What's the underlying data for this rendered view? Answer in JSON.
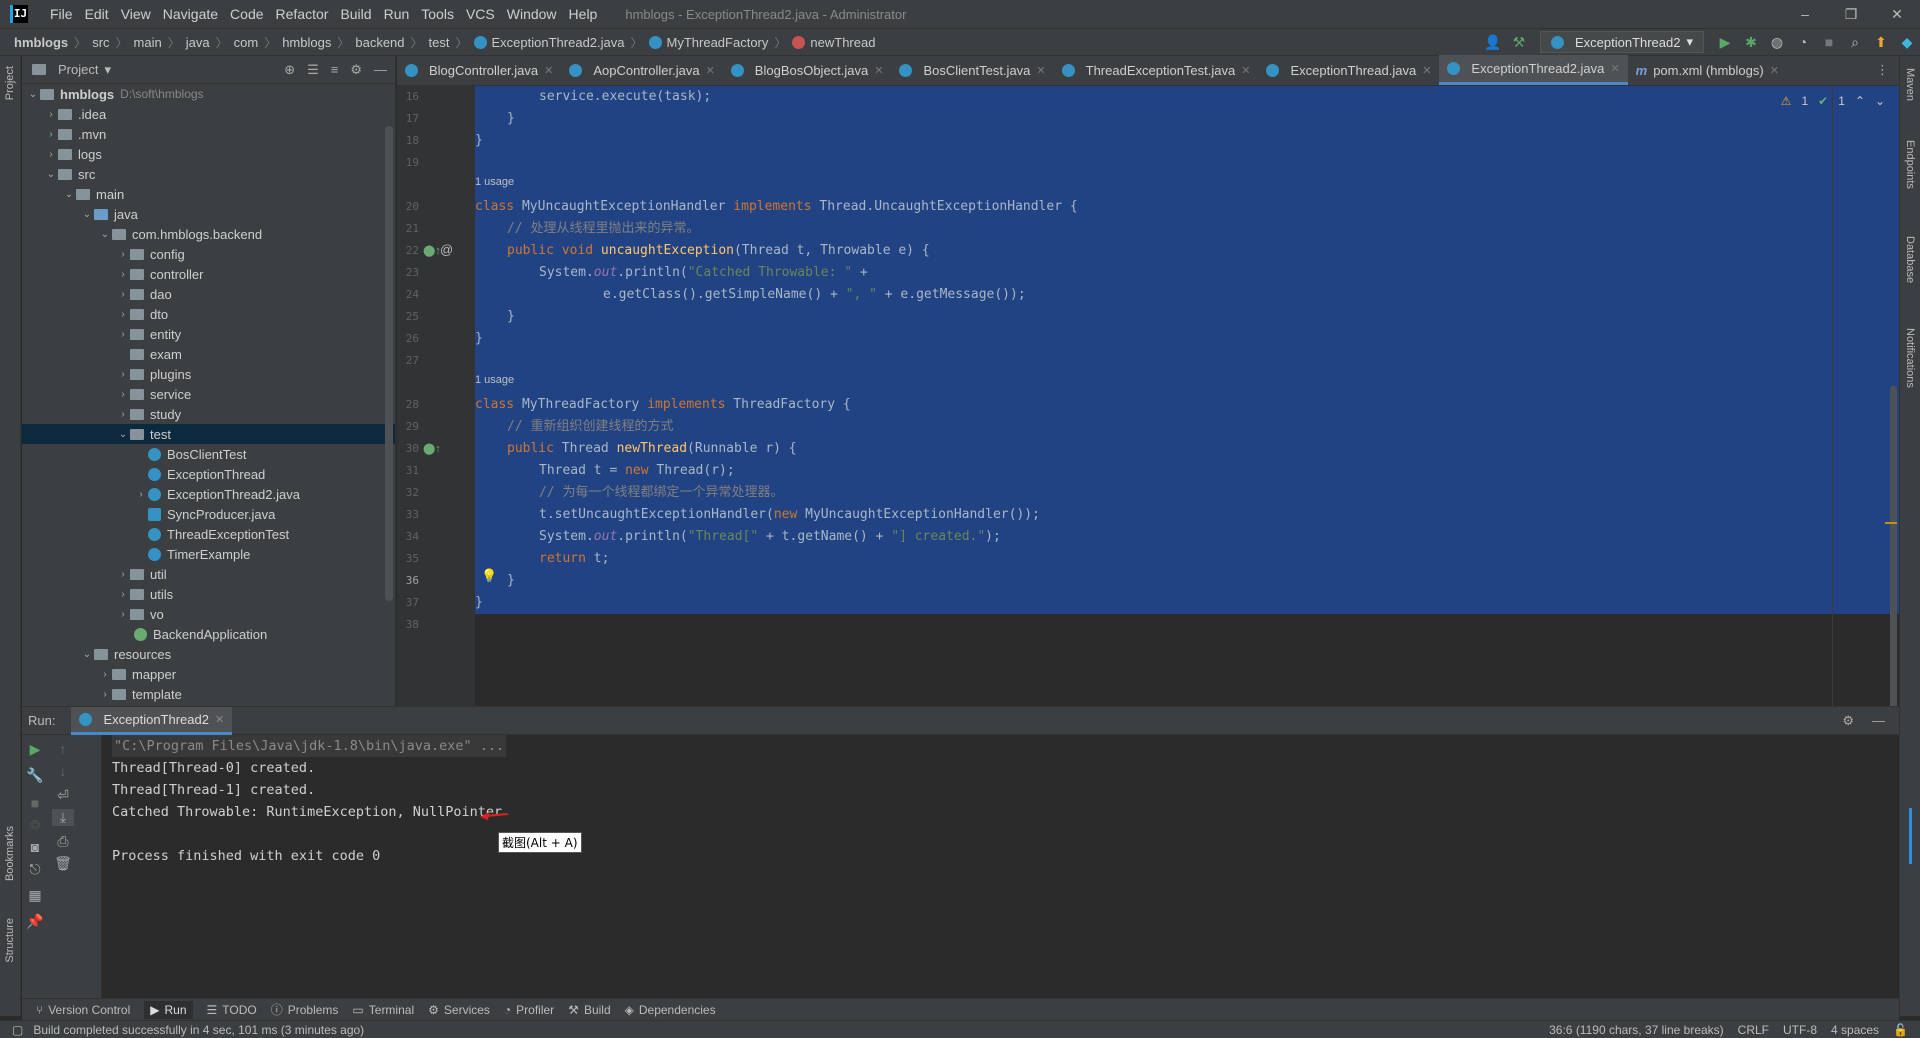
{
  "menubar": {
    "logo": "IJ",
    "items": [
      "File",
      "Edit",
      "View",
      "Navigate",
      "Code",
      "Refactor",
      "Build",
      "Run",
      "Tools",
      "VCS",
      "Window",
      "Help"
    ],
    "window_title": "hmblogs - ExceptionThread2.java - Administrator"
  },
  "breadcrumb": [
    "hmblogs",
    "src",
    "main",
    "java",
    "com",
    "hmblogs",
    "backend",
    "test",
    "ExceptionThread2.java",
    "MyThreadFactory",
    "newThread"
  ],
  "run_config": "ExceptionThread2",
  "project": {
    "title": "Project",
    "root_name": "hmblogs",
    "root_path": "D:\\soft\\hmblogs",
    "items": [
      ".idea",
      ".mvn",
      "logs",
      "src",
      "main",
      "java",
      "com.hmblogs.backend",
      "config",
      "controller",
      "dao",
      "dto",
      "entity",
      "exam",
      "plugins",
      "service",
      "study",
      "test",
      "BosClientTest",
      "ExceptionThread",
      "ExceptionThread2.java",
      "SyncProducer.java",
      "ThreadExceptionTest",
      "TimerExample",
      "util",
      "utils",
      "vo",
      "BackendApplication",
      "resources",
      "mapper",
      "template"
    ]
  },
  "editor_tabs": [
    "BlogController.java",
    "AopController.java",
    "BlogBosObject.java",
    "BosClientTest.java",
    "ThreadExceptionTest.java",
    "ExceptionThread.java",
    "ExceptionThread2.java",
    "pom.xml (hmblogs)"
  ],
  "inspections": {
    "warnings": "1",
    "ok": "1"
  },
  "code": {
    "line_numbers": [
      "16",
      "17",
      "18",
      "19",
      "20",
      "21",
      "22",
      "23",
      "24",
      "25",
      "26",
      "27",
      "28",
      "29",
      "30",
      "31",
      "32",
      "33",
      "34",
      "35",
      "36",
      "37",
      "38"
    ],
    "usage_hint": "1 usage",
    "l16": "service.execute(task);",
    "l17": "}",
    "l18": "}",
    "l20_kw": "class",
    "l20_name": " MyUncaughtExceptionHandler ",
    "l20_impl": "implements",
    "l20_rest": " Thread.UncaughtExceptionHandler {",
    "l21": "// 处理从线程里抛出来的异常。",
    "l22_a": "public void ",
    "l22_fn": "uncaughtException",
    "l22_b": "(Thread t, Throwable e) {",
    "l23_a": "System.",
    "l23_out": "out",
    "l23_b": ".println(",
    "l23_str": "\"Catched Throwable: \"",
    "l23_c": " +",
    "l24_a": "e.getClass().getSimpleName() + ",
    "l24_str": "\", \"",
    "l24_b": " + e.getMessage());",
    "l25": "}",
    "l26": "}",
    "l28_kw": "class",
    "l28_name": " MyThreadFactory ",
    "l28_impl": "implements",
    "l28_rest": " ThreadFactory {",
    "l29": "// 重新组织创建线程的方式",
    "l30_a": "public ",
    "l30_t": "Thread ",
    "l30_fn": "newThread",
    "l30_b": "(Runnable r) {",
    "l31_a": "Thread t = ",
    "l31_new": "new",
    "l31_b": " Thread(r);",
    "l32": "// 为每一个线程都绑定一个异常处理器。",
    "l33_a": "t.setUncaughtExceptionHandler(",
    "l33_new": "new",
    "l33_b": " MyUncaughtExceptionHandler());",
    "l34_a": "System.",
    "l34_out": "out",
    "l34_b": ".println(",
    "l34_str1": "\"Thread[\"",
    "l34_c": " + t.getName() + ",
    "l34_str2": "\"] created.\"",
    "l34_d": ");",
    "l35_kw": "return",
    "l35_b": " t;",
    "l36": "}",
    "l37": "}"
  },
  "run_panel": {
    "label": "Run:",
    "tab": "ExceptionThread2",
    "lines": [
      "\"C:\\Program Files\\Java\\jdk-1.8\\bin\\java.exe\" ...",
      "Thread[Thread-0] created.",
      "Thread[Thread-1] created.",
      "Catched Throwable: RuntimeException, NullPointer",
      "",
      "Process finished with exit code 0"
    ],
    "tooltip": "截图(Alt + A)"
  },
  "tool_windows": [
    "Version Control",
    "Run",
    "TODO",
    "Problems",
    "Terminal",
    "Services",
    "Profiler",
    "Build",
    "Dependencies"
  ],
  "side_labels": {
    "left": [
      "Project",
      "Bookmarks",
      "Structure"
    ],
    "right": [
      "Maven",
      "Endpoints",
      "Database",
      "Notifications"
    ]
  },
  "status": {
    "message": "Build completed successfully in 4 sec, 101 ms (3 minutes ago)",
    "position": "36:6 (1190 chars, 37 line breaks)",
    "line_sep": "CRLF",
    "encoding": "UTF-8",
    "indent": "4 spaces"
  }
}
